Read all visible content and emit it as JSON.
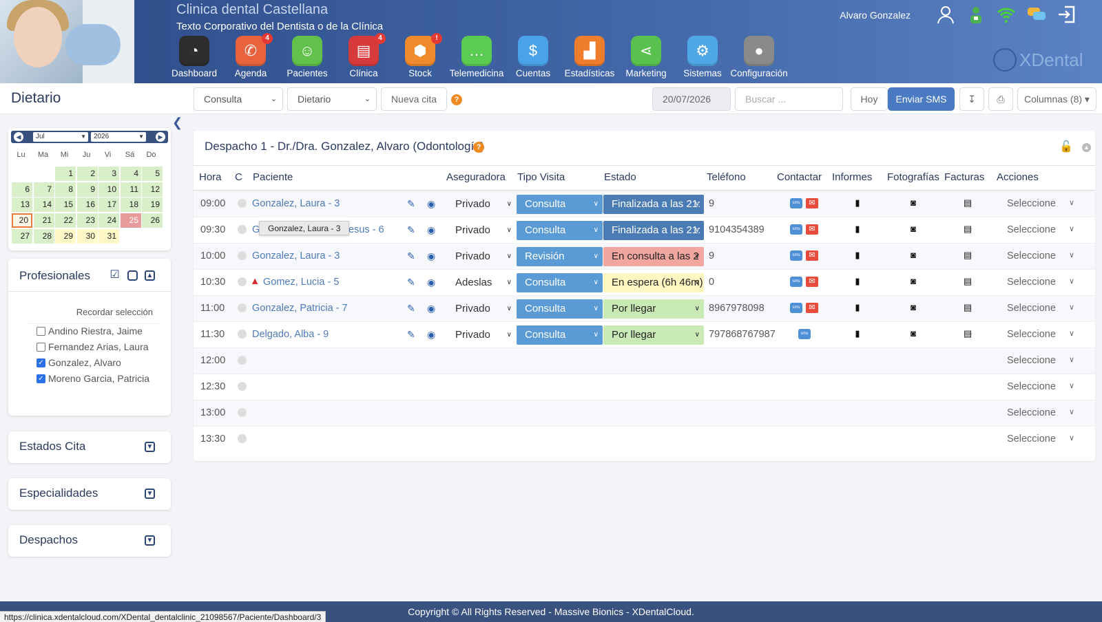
{
  "header": {
    "clinic_name": "Clinica dental Castellana",
    "clinic_sub": "Texto Corporativo del Dentista o de la Clínica",
    "user_name": "Alvaro Gonzalez",
    "logo_text": "XDental",
    "nav": [
      {
        "label": "Dashboard",
        "icon": "speedometer-icon",
        "color": "#2d2d2d",
        "badge": ""
      },
      {
        "label": "Agenda",
        "icon": "phone-icon",
        "color": "#e8623d",
        "badge": "4"
      },
      {
        "label": "Pacientes",
        "icon": "patient-icon",
        "color": "#61c14a",
        "badge": ""
      },
      {
        "label": "Clínica",
        "icon": "clipboard-icon",
        "color": "#d63a3a",
        "badge": "4"
      },
      {
        "label": "Stock",
        "icon": "box-icon",
        "color": "#f08a2c",
        "badge": "!"
      },
      {
        "label": "Telemedicina",
        "icon": "chat-icon",
        "color": "#5ccb52",
        "badge": ""
      },
      {
        "label": "Cuentas",
        "icon": "money-hand-icon",
        "color": "#4aa3e8",
        "badge": ""
      },
      {
        "label": "Estadísticas",
        "icon": "chart-icon",
        "color": "#f07d2c",
        "badge": ""
      },
      {
        "label": "Marketing",
        "icon": "share-icon",
        "color": "#59c24e",
        "badge": ""
      },
      {
        "label": "Sistemas",
        "icon": "gear-icon",
        "color": "#4fa7e6",
        "badge": ""
      },
      {
        "label": "Configuración",
        "icon": "user-gear-icon",
        "color": "#8a8a8a",
        "badge": ""
      }
    ]
  },
  "toolbar": {
    "title": "Dietario",
    "select1": "Consulta",
    "select2": "Dietario",
    "new_appt": "Nueva cita",
    "date": "20/07/2026",
    "search_placeholder": "Buscar ...",
    "today": "Hoy",
    "send_sms": "Enviar SMS",
    "columns": "Columnas (8)"
  },
  "calendar": {
    "month": "Jul",
    "year": "2026",
    "dow": [
      "Lu",
      "Ma",
      "Mi",
      "Ju",
      "Vi",
      "Sá",
      "Do"
    ]
  },
  "professionals": {
    "title": "Profesionales",
    "remember": "Recordar selección",
    "items": [
      {
        "name": "Andino Riestra, Jaime",
        "checked": false
      },
      {
        "name": "Fernandez Arias, Laura",
        "checked": false
      },
      {
        "name": "Gonzalez, Alvaro",
        "checked": true
      },
      {
        "name": "Moreno Garcia, Patricia",
        "checked": true
      }
    ]
  },
  "panels": {
    "estados": "Estados Cita",
    "especialidades": "Especialidades",
    "despachos": "Despachos"
  },
  "main": {
    "title": "Despacho 1 - Dr./Dra. Gonzalez, Alvaro (Odontología)",
    "headers": [
      "Hora",
      "C",
      "Paciente",
      "Aseguradora",
      "Tipo Visita",
      "Estado",
      "Teléfono",
      "Contactar",
      "Informes",
      "Fotografías",
      "Facturas",
      "Acciones"
    ],
    "rows": [
      {
        "time": "09:00",
        "patient": "Gonzalez, Laura - 3",
        "aseg": "Privado",
        "tipo": "Consulta",
        "estado": "Finalizada a las 21:",
        "estado_color": "#4a7bb5",
        "estado_text_color": "#ffffff",
        "tel": "9",
        "mail": true,
        "action": "Seleccione",
        "warn": false
      },
      {
        "time": "09:30",
        "patient": "Go",
        "patient_tail": "esus - 6",
        "aseg": "Privado",
        "tipo": "Consulta",
        "estado": "Finalizada a las 21:",
        "estado_color": "#4a7bb5",
        "estado_text_color": "#ffffff",
        "tel": "9104354389",
        "mail": true,
        "action": "Seleccione",
        "warn": false
      },
      {
        "time": "10:00",
        "patient": "Gonzalez, Laura - 3",
        "aseg": "Privado",
        "tipo": "Revisión",
        "estado": "En consulta a las 2",
        "estado_color": "#f2a6a0",
        "estado_text_color": "#222222",
        "tel": "9",
        "mail": true,
        "action": "Seleccione",
        "warn": false
      },
      {
        "time": "10:30",
        "patient": "Gomez, Lucia - 5",
        "aseg": "Adeslas",
        "tipo": "Consulta",
        "estado": "En espera (6h 46m)",
        "estado_color": "#fff6c2",
        "estado_text_color": "#222222",
        "tel": "0",
        "mail": true,
        "action": "Seleccione",
        "warn": true
      },
      {
        "time": "11:00",
        "patient": "Gonzalez, Patricia - 7",
        "aseg": "Privado",
        "tipo": "Consulta",
        "estado": "Por llegar",
        "estado_color": "#c9eab5",
        "estado_text_color": "#222222",
        "tel": "8967978098",
        "mail": true,
        "action": "Seleccione",
        "warn": false
      },
      {
        "time": "11:30",
        "patient": "Delgado, Alba - 9",
        "aseg": "Privado",
        "tipo": "Consulta",
        "estado": "Por llegar",
        "estado_color": "#c9eab5",
        "estado_text_color": "#222222",
        "tel": "797868767987",
        "mail": false,
        "action": "Seleccione",
        "warn": false
      },
      {
        "time": "12:00",
        "action": "Seleccione"
      },
      {
        "time": "12:30",
        "action": "Seleccione"
      },
      {
        "time": "13:00",
        "action": "Seleccione"
      },
      {
        "time": "13:30",
        "action": "Seleccione"
      }
    ],
    "tooltip": "Gonzalez, Laura - 3"
  },
  "footer": {
    "copyright": "Copyright © All Rights Reserved - Massive Bionics - XDentalCloud.",
    "status_url": "https://clinica.xdentalcloud.com/XDental_dentalclinic_21098567/Paciente/Dashboard/3"
  }
}
